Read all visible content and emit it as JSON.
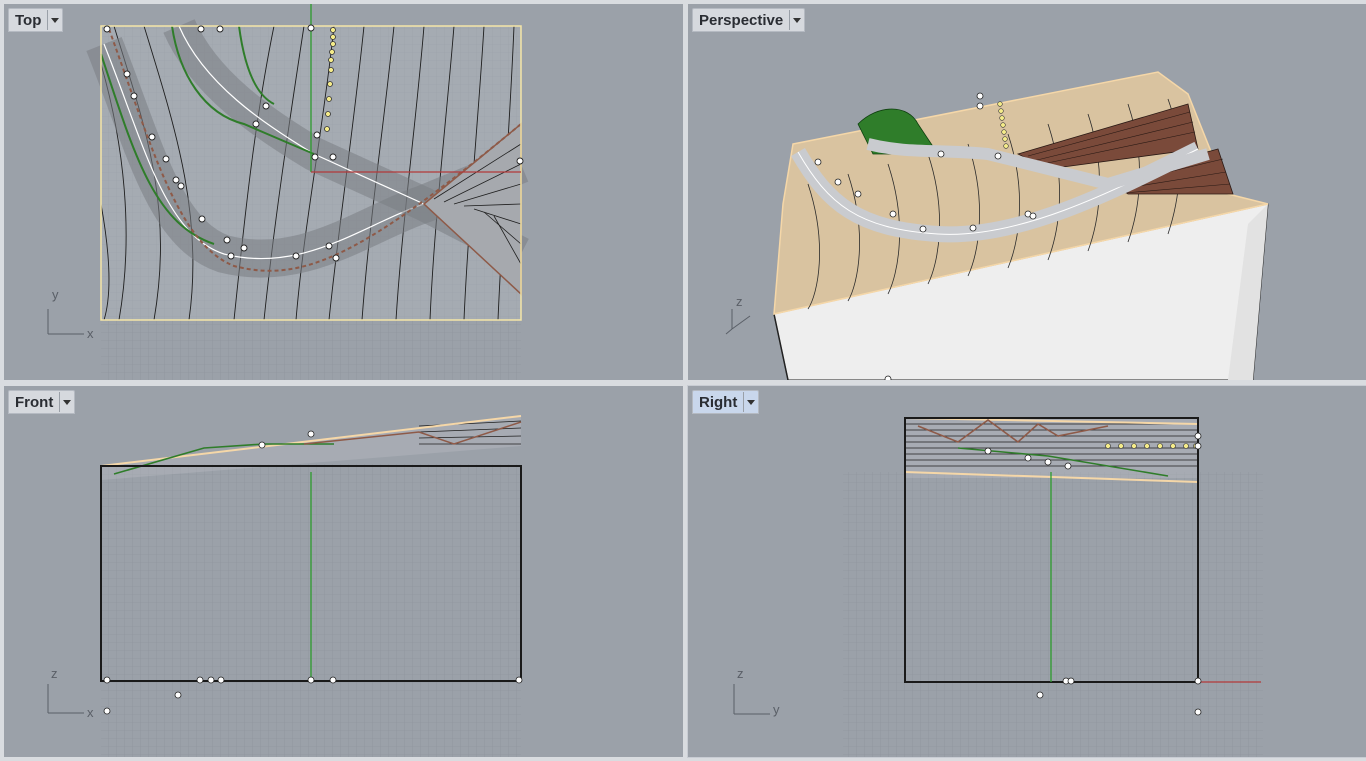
{
  "viewports": [
    {
      "id": "top",
      "title": "Top",
      "axes": [
        "y",
        "x"
      ],
      "active": false
    },
    {
      "id": "perspective",
      "title": "Perspective",
      "axes": [
        "z",
        "",
        ""
      ],
      "active": false
    },
    {
      "id": "front",
      "title": "Front",
      "axes": [
        "z",
        "x"
      ],
      "active": false
    },
    {
      "id": "right",
      "title": "Right",
      "axes": [
        "z",
        "y"
      ],
      "active": true
    }
  ],
  "icons": {
    "dropdown": "chevron-down-icon",
    "axis": "axis-gizmo-icon"
  },
  "colors": {
    "background": "#9ba1a9",
    "grid": "#8d939b",
    "terrain": "#d9c3a0",
    "road": "#c9cbcf",
    "green_edge": "#2f7d2a",
    "brown": "#8e5a48",
    "selection": "#f5e6a8",
    "axis_green": "#2d9b2d",
    "axis_red": "#b33a3a"
  }
}
